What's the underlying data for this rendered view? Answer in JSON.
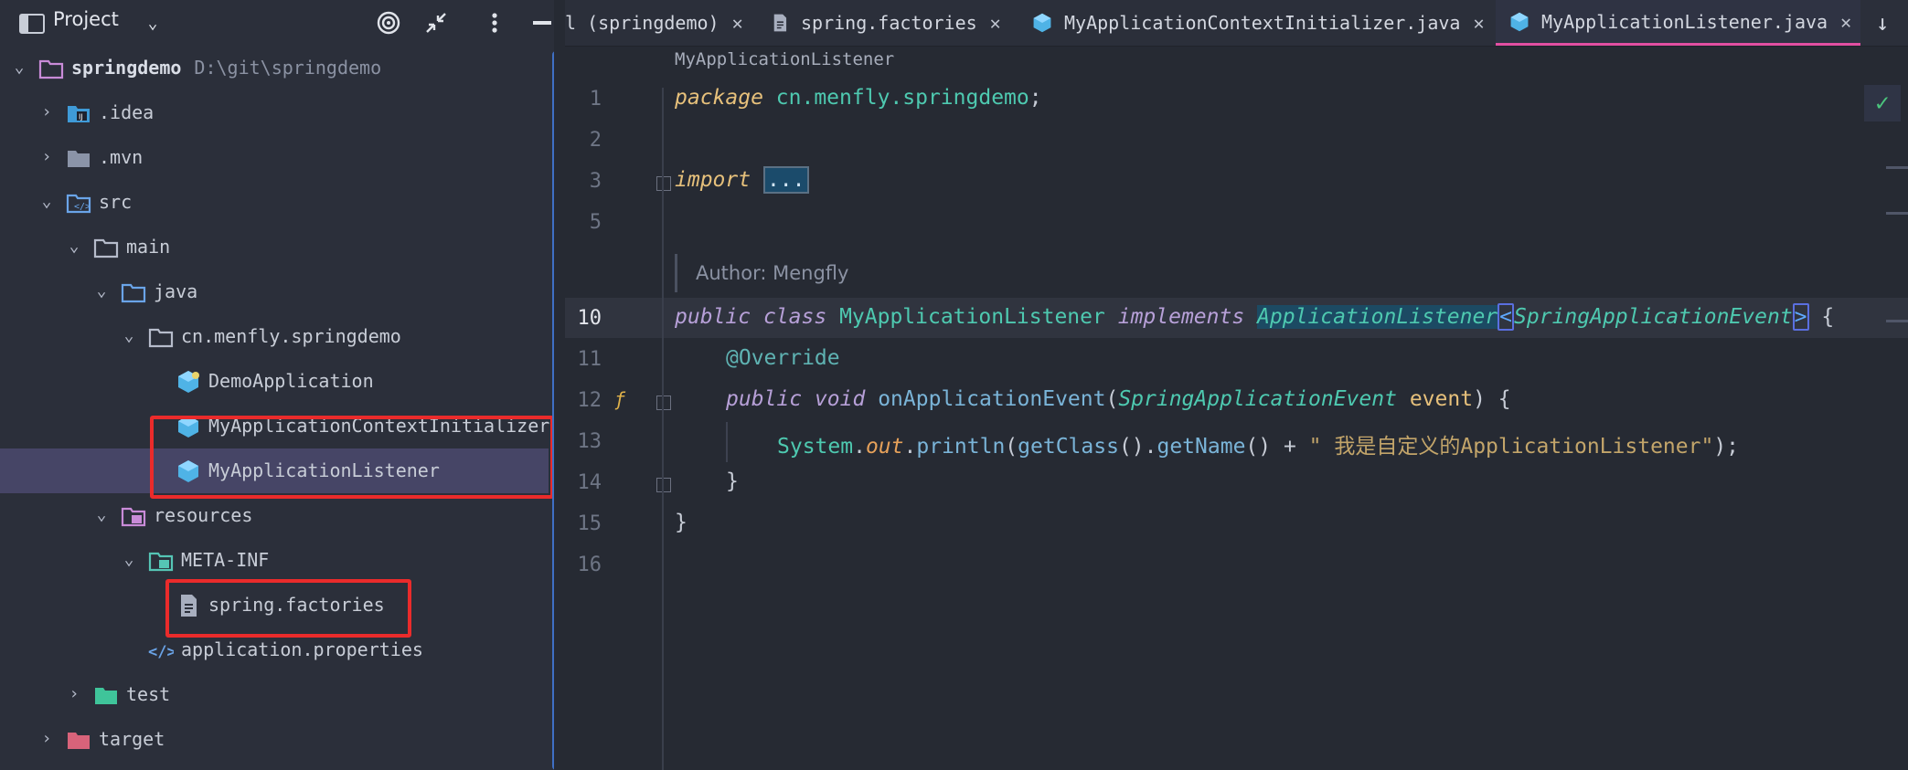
{
  "sidebar": {
    "title": "Project",
    "root": {
      "name": "springdemo",
      "path": "D:\\git\\springdemo"
    },
    "items": [
      {
        "label": ".idea"
      },
      {
        "label": ".mvn"
      },
      {
        "label": "src"
      },
      {
        "label": "main"
      },
      {
        "label": "java"
      },
      {
        "label": "cn.menfly.springdemo"
      },
      {
        "label": "DemoApplication"
      },
      {
        "label": "MyApplicationContextInitializer"
      },
      {
        "label": "MyApplicationListener"
      },
      {
        "label": "resources"
      },
      {
        "label": "META-INF"
      },
      {
        "label": "spring.factories"
      },
      {
        "label": "application.properties"
      },
      {
        "label": "test"
      },
      {
        "label": "target"
      }
    ]
  },
  "tabs": [
    {
      "label": "l (springdemo)"
    },
    {
      "label": "spring.factories"
    },
    {
      "label": "MyApplicationContextInitializer.java"
    },
    {
      "label": "MyApplicationListener.java"
    }
  ],
  "editor": {
    "breadcrumb": "MyApplicationListener",
    "line_numbers": [
      "1",
      "2",
      "3",
      "5",
      "10",
      "11",
      "12",
      "13",
      "14",
      "15",
      "16"
    ],
    "author_label": "Author:",
    "author_name": "Mengfly",
    "code": {
      "l1_kw": "package",
      "l1_pkg": "cn.menfly.springdemo",
      "l1_end": ";",
      "l3_kw": "import",
      "l3_fold": "...",
      "l10_public": "public",
      "l10_class": "class",
      "l10_name": "MyApplicationListener",
      "l10_impl": "implements",
      "l10_iface": "ApplicationListener",
      "l10_lt": "<",
      "l10_type": "SpringApplicationEvent",
      "l10_gt": ">",
      "l10_brace": "{",
      "l11_ann": "@Override",
      "l12_public": "public",
      "l12_void": "void",
      "l12_method": "onApplicationEvent",
      "l12_open": "(",
      "l12_type": "SpringApplicationEvent",
      "l12_param": "event",
      "l12_close": ") {",
      "l13_system": "System",
      "l13_dot1": ".",
      "l13_out": "out",
      "l13_dot2": ".",
      "l13_println": "println",
      "l13_open": "(",
      "l13_getclass": "getClass",
      "l13_paren1": "().",
      "l13_getname": "getName",
      "l13_paren2": "() + ",
      "l13_str": "\" 我是自定义的ApplicationListener\"",
      "l13_end": ");",
      "l14": "}",
      "l15": "}"
    }
  },
  "colors": {
    "sidebar_bg": "#2b2f3a",
    "editor_bg": "#262a33",
    "selection": "#464566",
    "highlight_box": "#ea2b2b",
    "active_tab_underline": "#e24fa2"
  }
}
